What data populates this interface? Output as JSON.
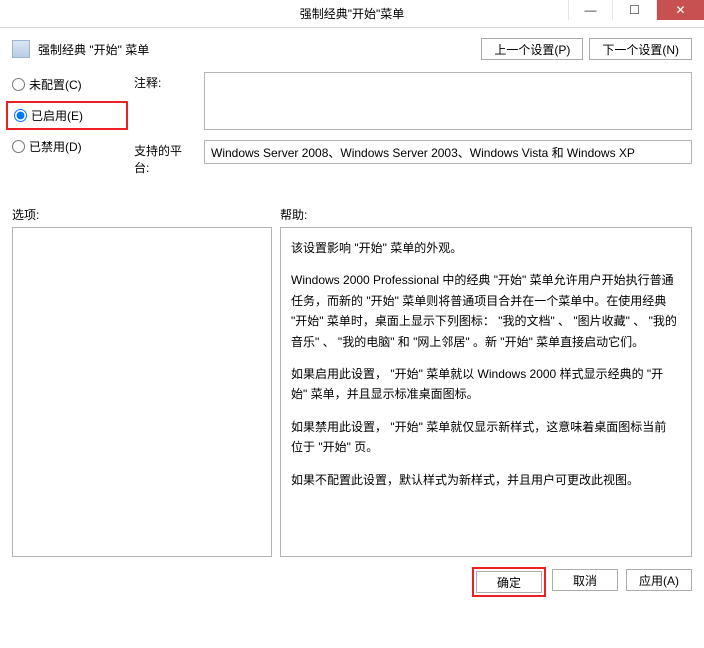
{
  "window": {
    "title": "强制经典\"开始\"菜单"
  },
  "header": {
    "title": "强制经典 \"开始\" 菜单",
    "prev_btn": "上一个设置(P)",
    "next_btn": "下一个设置(N)"
  },
  "radios": {
    "not_configured": "未配置(C)",
    "enabled": "已启用(E)",
    "disabled": "已禁用(D)"
  },
  "fields": {
    "comment_label": "注释:",
    "comment_value": "",
    "platform_label": "支持的平台:",
    "platform_value": "Windows Server 2008、Windows Server 2003、Windows Vista 和 Windows XP"
  },
  "panels": {
    "options_label": "选项:",
    "help_label": "帮助:"
  },
  "help_text": {
    "p1": "该设置影响 \"开始\" 菜单的外观。",
    "p2": "Windows 2000 Professional 中的经典 \"开始\" 菜单允许用户开始执行普通任务，而新的 \"开始\" 菜单则将普通项目合并在一个菜单中。在使用经典 \"开始\" 菜单时，桌面上显示下列图标： \"我的文档\" 、 \"图片收藏\" 、 \"我的音乐\" 、 \"我的电脑\" 和 \"网上邻居\" 。新 \"开始\" 菜单直接启动它们。",
    "p3": "如果启用此设置， \"开始\" 菜单就以 Windows 2000 样式显示经典的 \"开始\" 菜单，并且显示标准桌面图标。",
    "p4": "如果禁用此设置， \"开始\" 菜单就仅显示新样式，这意味着桌面图标当前位于 \"开始\" 页。",
    "p5": "如果不配置此设置，默认样式为新样式，并且用户可更改此视图。"
  },
  "footer": {
    "ok": "确定",
    "cancel": "取消",
    "apply": "应用(A)"
  }
}
